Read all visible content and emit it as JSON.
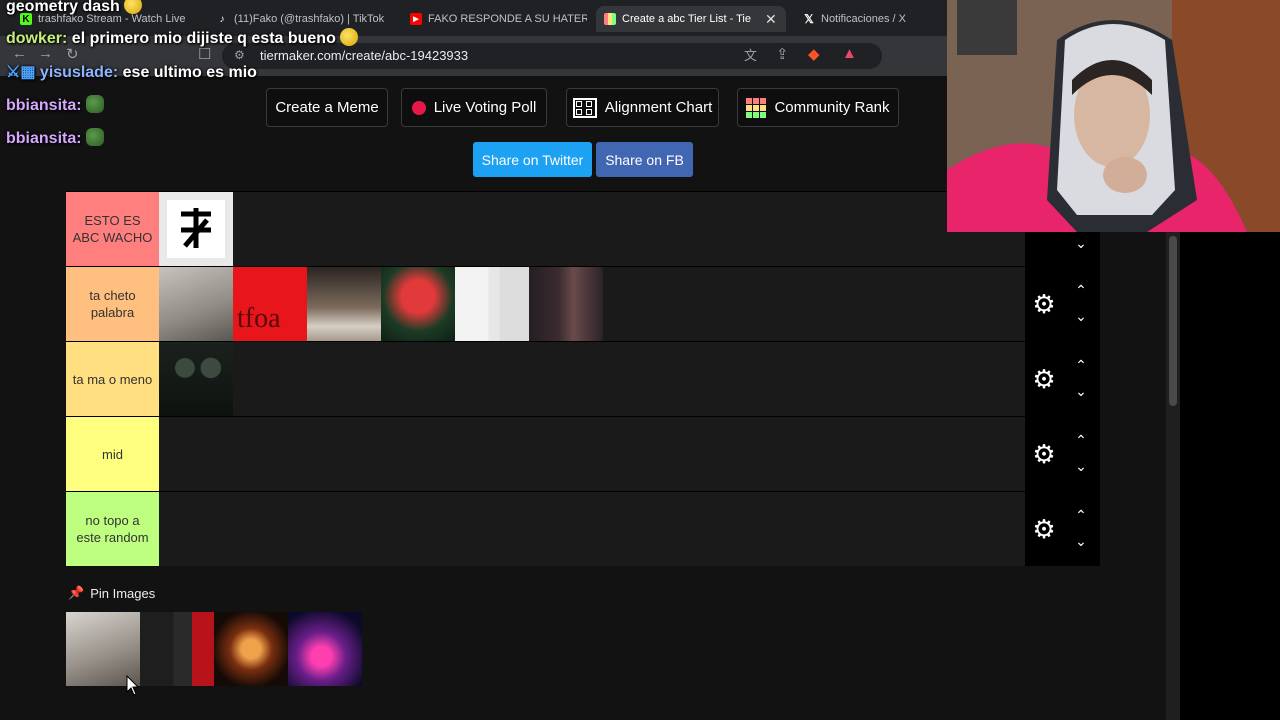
{
  "browser": {
    "tabs": [
      {
        "title": "trashfako Stream - Watch Live",
        "favicon": "kick-icon",
        "active": false
      },
      {
        "title": "(11)Fako (@trashfako) | TikTok",
        "favicon": "tiktok-icon",
        "active": false
      },
      {
        "title": "FAKO RESPONDE A SU HATER",
        "favicon": "youtube-icon",
        "active": false
      },
      {
        "title": "Create a abc Tier List - Tie",
        "favicon": "tiermaker-icon",
        "active": true
      },
      {
        "title": "Notificaciones / X",
        "favicon": "x-icon",
        "active": false
      }
    ],
    "url": "tiermaker.com/create/abc-19423933"
  },
  "chat": [
    {
      "user": "geometry dash",
      "text": "",
      "user_color": "#ffffff",
      "emote": "yellow"
    },
    {
      "user": "dowker:",
      "text": "el primero mio dijiste q esta bueno",
      "user_color": "#c7f07a",
      "emote": "yellow"
    },
    {
      "user": "yisuslade:",
      "text": "ese ultimo es mio",
      "user_color": "#8fb4ff",
      "emote": ""
    },
    {
      "user": "bbiansita:",
      "text": "",
      "user_color": "#d5a6ff",
      "emote": "green"
    },
    {
      "user": "bbiansita:",
      "text": "",
      "user_color": "#d5a6ff",
      "emote": "green"
    }
  ],
  "actions": {
    "create_meme": "Create a Meme",
    "live_voting": "Live Voting Poll",
    "alignment_chart": "Alignment Chart",
    "community_rank": "Community Rank",
    "share_twitter": "Share on Twitter",
    "share_fb": "Share on FB"
  },
  "tiers": [
    {
      "label": "ESTO ES ABC WACHO",
      "color": "#ff7f7f",
      "items": 1
    },
    {
      "label": "ta cheto palabra",
      "color": "#ffbf7f",
      "items": 6
    },
    {
      "label": "ta ma o meno",
      "color": "#ffdf7f",
      "items": 1
    },
    {
      "label": "mid",
      "color": "#ffff7f",
      "items": 0
    },
    {
      "label": "no topo a este random",
      "color": "#bfff7f",
      "items": 0
    }
  ],
  "pin": {
    "label": "Pin Images",
    "items": 4
  },
  "colors": {
    "twitter": "#1da1f2",
    "facebook": "#4267b2"
  }
}
